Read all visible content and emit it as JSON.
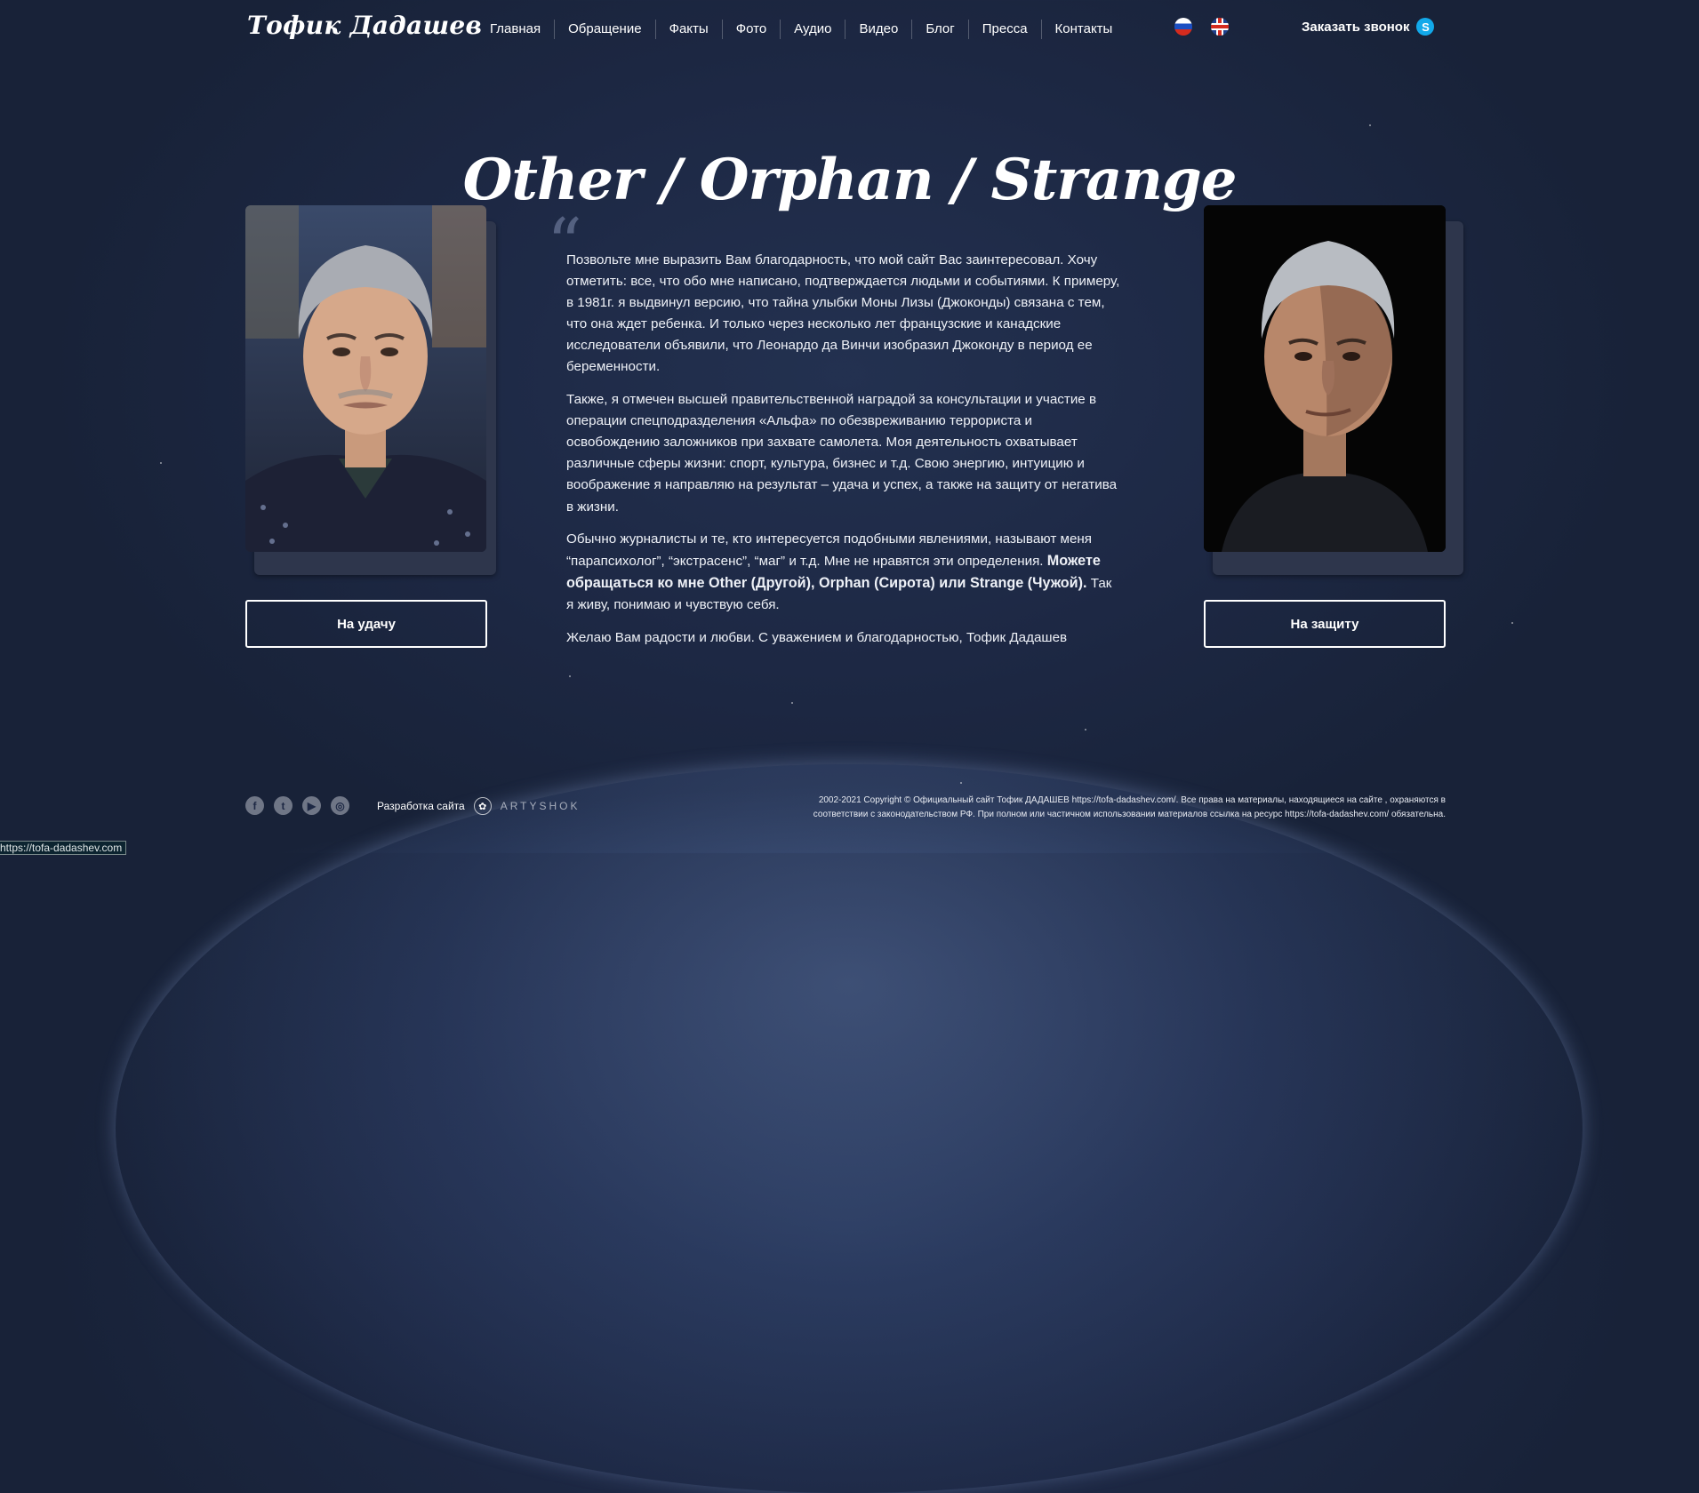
{
  "header": {
    "logo": "Тофик Дадашев",
    "nav": [
      "Главная",
      "Обращение",
      "Факты",
      "Фото",
      "Аудио",
      "Видео",
      "Блог",
      "Пресса",
      "Контакты"
    ],
    "callback_label": "Заказать звонок",
    "languages": [
      "ru",
      "en"
    ]
  },
  "main": {
    "title": "Other / Orphan / Strange",
    "paragraphs": [
      "Позвольте мне выразить Вам благодарность, что мой сайт Вас заинтересовал. Хочу отметить: все, что обо мне написано, подтверждается людьми и событиями. К примеру, в 1981г. я выдвинул версию, что тайна улыбки Моны Лизы (Джоконды) связана с тем, что она ждет ребенка. И только через несколько лет французские и канадские исследователи объявили, что Леонардо да Винчи изобразил Джоконду в период ее беременности.",
      "Также, я отмечен высшей правительственной наградой за консультации и участие в операции спецподразделения «Альфа» по обезвреживанию террориста и освобождению заложников при захвате самолета. Моя деятельность охватывает различные сферы жизни: спорт, культура, бизнес и т.д. Свою энергию, интуицию и воображение я направляю на результат – удача и успех, а также на защиту от негатива в жизни."
    ],
    "p3_before": "Обычно журналисты и те, кто интересуется подобными явлениями, называют меня “парапсихолог”, “экстрасенс”, “маг” и т.д. Мне не нравятся эти определения. ",
    "p3_bold": "Можете обращаться ко мне Other (Другой), Orphan (Сирота) или Strange (Чужой).",
    "p3_after": " Так я живу, понимаю и чувствую себя.",
    "closing": "Желаю Вам радости и любви. С уважением и благодарностью, Тофик Дадашев",
    "btn_left": "На удачу",
    "btn_right": "На защиту"
  },
  "footer": {
    "social_icons": [
      "facebook-icon",
      "twitter-icon",
      "youtube-icon",
      "instagram-icon"
    ],
    "dev_label": "Разработка сайта",
    "dev_brand": "ARTYSHOK",
    "copyright_line1": "2002-2021 Copyright © Официальный сайт Тофик ДАДАШЕВ https://tofa-dadashev.com/. Все права на материалы, находящиеся на сайте , охраняются в",
    "copyright_line2": "соответствии с законодательством РФ. При полном или частичном использовании материалов ссылка на ресурс https://tofa-dadashev.com/ обязательна."
  },
  "status_url": "https://tofa-dadashev.com",
  "colors": {
    "background": "#1d2844",
    "skype": "#12a9ea",
    "text": "#ffffff"
  }
}
